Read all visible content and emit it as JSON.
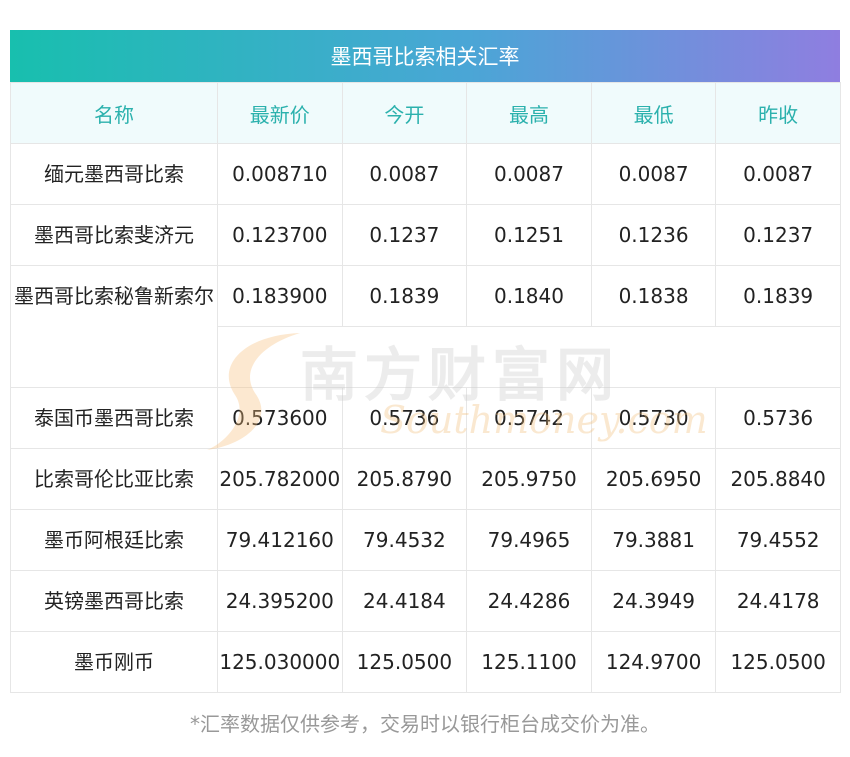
{
  "title": "墨西哥比索相关汇率",
  "headers": [
    "名称",
    "最新价",
    "今开",
    "最高",
    "最低",
    "昨收"
  ],
  "rows": [
    {
      "name": "缅元墨西哥比索",
      "latest": "0.008710",
      "open": "0.0087",
      "high": "0.0087",
      "low": "0.0087",
      "prev_close": "0.0087"
    },
    {
      "name": "墨西哥比索斐济元",
      "latest": "0.123700",
      "open": "0.1237",
      "high": "0.1251",
      "low": "0.1236",
      "prev_close": "0.1237"
    },
    {
      "name": "墨西哥比索秘鲁新索尔",
      "latest": "0.183900",
      "open": "0.1839",
      "high": "0.1840",
      "low": "0.1838",
      "prev_close": "0.1839"
    },
    {
      "name": "泰国币墨西哥比索",
      "latest": "0.573600",
      "open": "0.5736",
      "high": "0.5742",
      "low": "0.5730",
      "prev_close": "0.5736"
    },
    {
      "name": "比索哥伦比亚比索",
      "latest": "205.782000",
      "open": "205.8790",
      "high": "205.9750",
      "low": "205.6950",
      "prev_close": "205.8840"
    },
    {
      "name": "墨币阿根廷比索",
      "latest": "79.412160",
      "open": "79.4532",
      "high": "79.4965",
      "low": "79.3881",
      "prev_close": "79.4552"
    },
    {
      "name": "英镑墨西哥比索",
      "latest": "24.395200",
      "open": "24.4184",
      "high": "24.4286",
      "low": "24.3949",
      "prev_close": "24.4178"
    },
    {
      "name": "墨币刚币",
      "latest": "125.030000",
      "open": "125.0500",
      "high": "125.1100",
      "low": "124.9700",
      "prev_close": "125.0500"
    }
  ],
  "watermark": {
    "cn": "南方财富网",
    "en": "Southmoney.com"
  },
  "footnote": "*汇率数据仅供参考，交易时以银行柜台成交价为准。",
  "colors": {
    "header_text": "#2bb1ad",
    "header_bg": "#f0fbfc",
    "title_gradient_start": "#18bfae",
    "title_gradient_end": "#8f7ee0"
  }
}
